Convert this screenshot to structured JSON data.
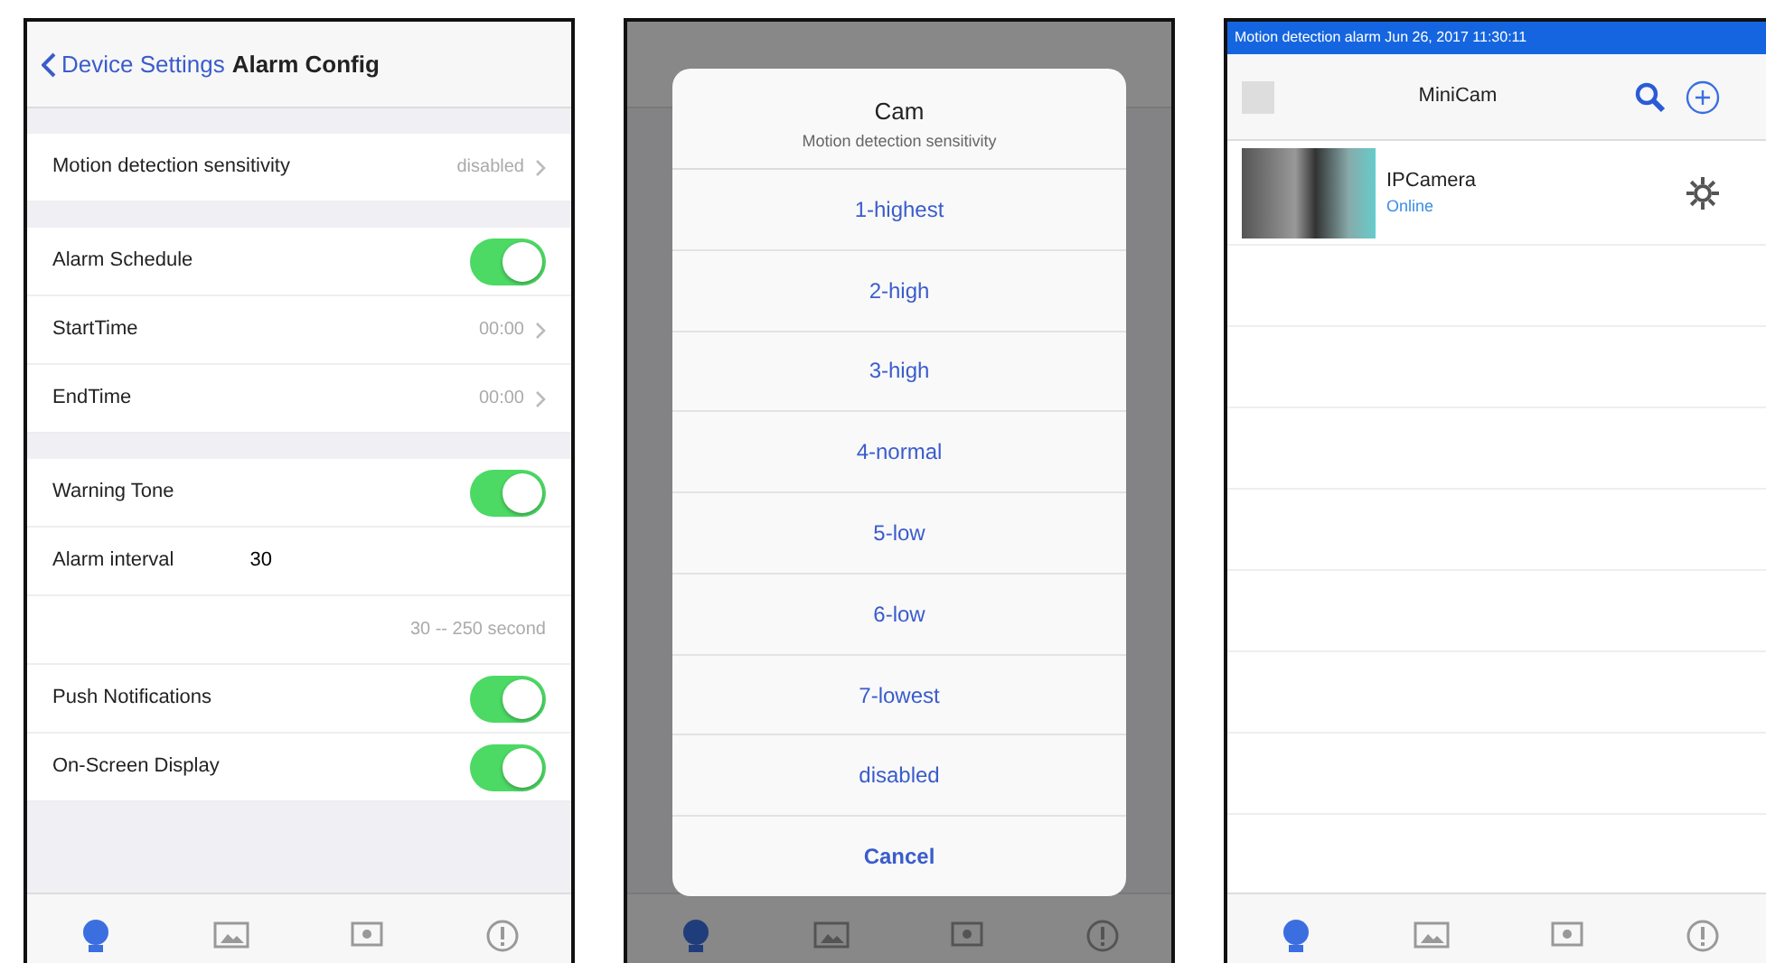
{
  "screens": [
    {
      "kind": "settings",
      "back_label": "Device Settings",
      "title": "Alarm Config",
      "groups": [
        [
          {
            "kind": "value",
            "label": "Motion detection sensitivity",
            "value": "disabled"
          }
        ],
        [
          {
            "kind": "switch",
            "label": "Alarm Schedule",
            "on": true
          },
          {
            "kind": "value",
            "label": "StartTime",
            "value": "00:00"
          },
          {
            "kind": "value",
            "label": "EndTime",
            "value": "00:00"
          }
        ],
        [
          {
            "kind": "switch",
            "label": "Warning Tone",
            "on": true
          },
          {
            "kind": "input",
            "label": "Alarm interval",
            "value": "30"
          },
          {
            "kind": "note",
            "text": "30 -- 250 second"
          },
          {
            "kind": "switch",
            "label": "Push Notifications",
            "on": true
          },
          {
            "kind": "switch",
            "label": "On-Screen Display",
            "on": true
          }
        ]
      ],
      "tabs": [
        {
          "kind": "video",
          "selected": true
        },
        {
          "kind": "image",
          "selected": false
        },
        {
          "kind": "record",
          "selected": false
        },
        {
          "kind": "info",
          "selected": false
        }
      ]
    },
    {
      "kind": "picker",
      "sheet": {
        "title": "Cam",
        "subtitle": "Motion detection sensitivity",
        "options": [
          "1-highest",
          "2-high",
          "3-high",
          "4-normal",
          "5-low",
          "6-low",
          "7-lowest",
          "disabled"
        ],
        "cancel": "Cancel"
      },
      "tabs": [
        {
          "kind": "video",
          "selected": true
        },
        {
          "kind": "image",
          "selected": false
        },
        {
          "kind": "record",
          "selected": false
        },
        {
          "kind": "info",
          "selected": false
        }
      ]
    },
    {
      "kind": "list",
      "banner": "Motion detection alarm Jun 26, 2017 11:30:11",
      "title": "MiniCam",
      "devices": [
        {
          "name": "IPCamera",
          "status": "Online"
        }
      ],
      "tabs": [
        {
          "kind": "video",
          "selected": true
        },
        {
          "kind": "image",
          "selected": false
        },
        {
          "kind": "record",
          "selected": false
        },
        {
          "kind": "info",
          "selected": false
        }
      ]
    }
  ]
}
